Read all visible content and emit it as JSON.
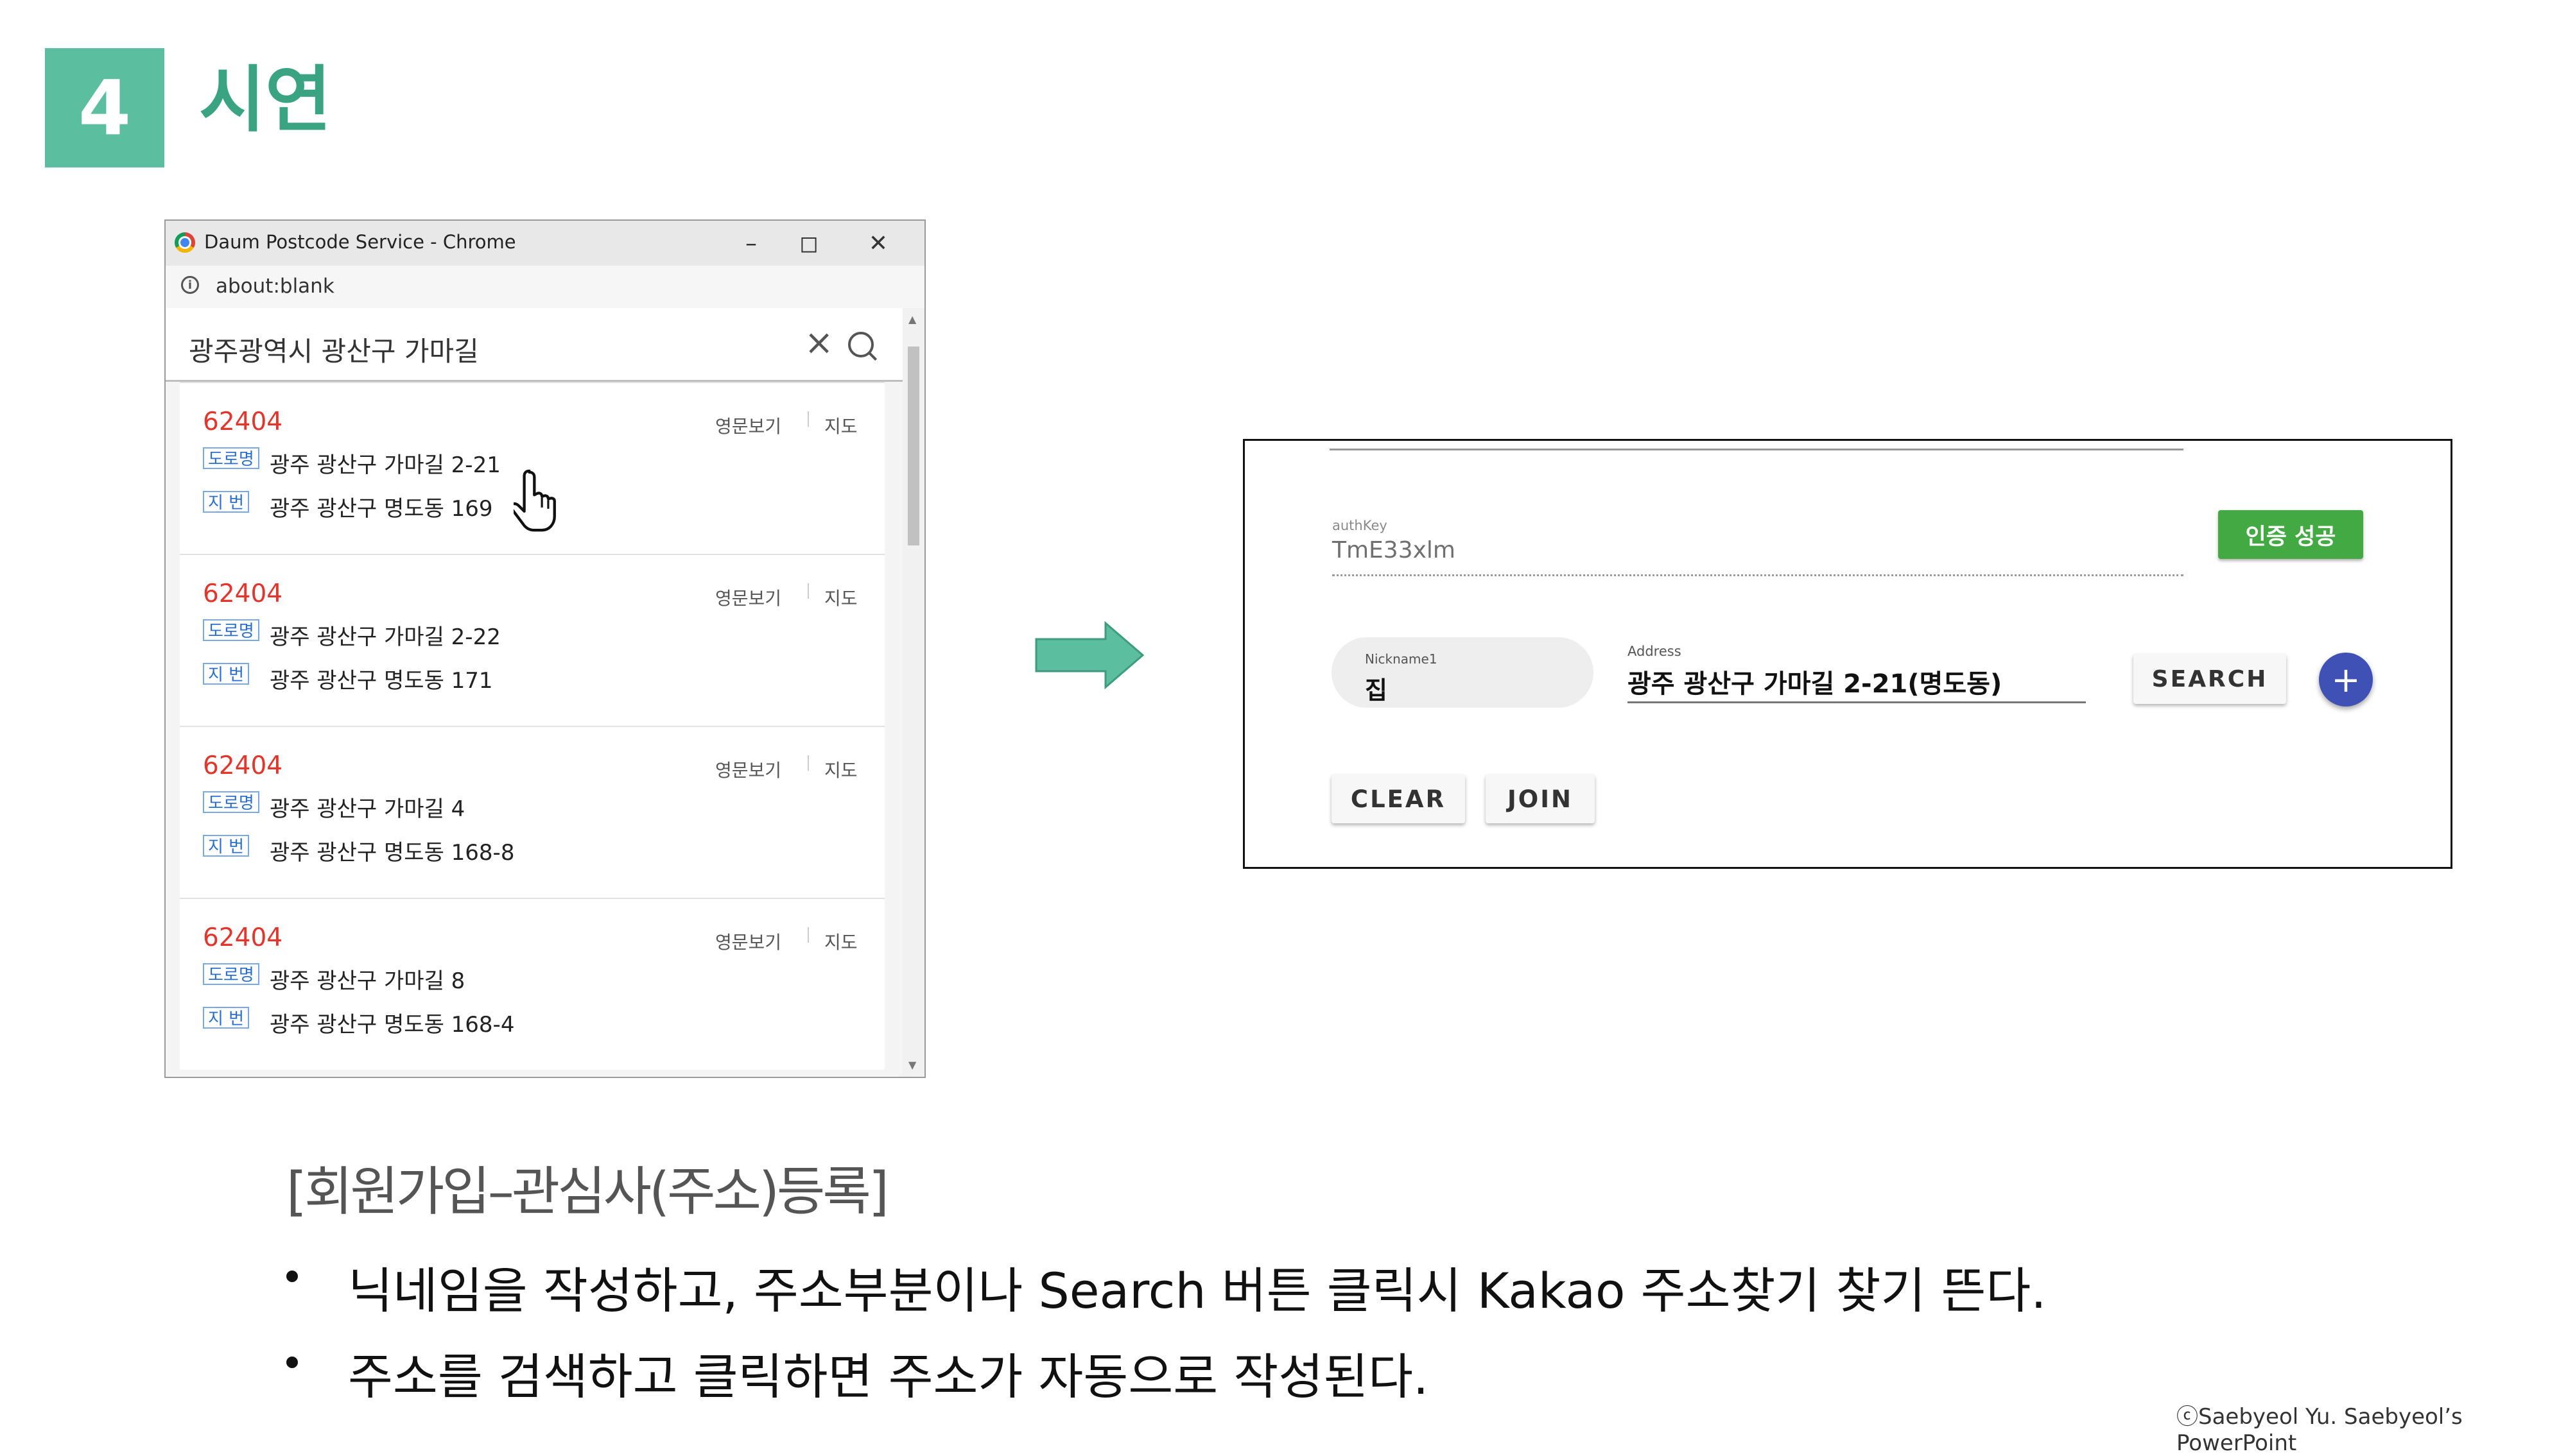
{
  "slide": {
    "number": "4",
    "title": "시연",
    "subtitle": "[회원가입–관심사(주소)등록]",
    "bullets": [
      "닉네임을 작성하고, 주소부분이나 Search 버튼 클릭시 Kakao 주소찾기 찾기 뜬다.",
      "주소를 검색하고 클릭하면 주소가 자동으로 작성된다."
    ],
    "copyright": "ⓒSaebyeol Yu. Saebyeol’s PowerPoint"
  },
  "popup": {
    "window_title": "Daum Postcode Service - Chrome",
    "url": "about:blank",
    "search_query": "광주광역시 광산구 가마길",
    "eng_label": "영문보기",
    "map_label": "지도",
    "road_tag": "도로명",
    "jibun_tag": "지 번",
    "results": [
      {
        "zip": "62404",
        "road": "광주 광산구 가마길 2-21",
        "jibun": "광주 광산구 명도동 169"
      },
      {
        "zip": "62404",
        "road": "광주 광산구 가마길 2-22",
        "jibun": "광주 광산구 명도동 171"
      },
      {
        "zip": "62404",
        "road": "광주 광산구 가마길 4",
        "jibun": "광주 광산구 명도동 168-8"
      },
      {
        "zip": "62404",
        "road": "광주 광산구 가마길 8",
        "jibun": "광주 광산구 명도동 168-4"
      }
    ]
  },
  "form": {
    "authkey_label": "authKey",
    "authkey_value": "TmE33xlm",
    "auth_button": "인증 성공",
    "nickname_label": "Nickname1",
    "nickname_value": "집",
    "address_label": "Address",
    "address_value": "광주 광산구 가마길 2-21(명도동)",
    "search_button": "SEARCH",
    "add_button": "+",
    "clear_button": "CLEAR",
    "join_button": "JOIN"
  },
  "colors": {
    "accent": "#5bbf9f",
    "title": "#3aa381",
    "zip_red": "#e2352b",
    "auth_green": "#43a943",
    "plus_indigo": "#3f51b5"
  },
  "icons": [
    "chrome-icon",
    "minimize-icon",
    "maximize-icon",
    "close-icon",
    "info-icon",
    "clear-icon",
    "search-icon",
    "hand-cursor-icon",
    "right-arrow-icon",
    "plus-icon"
  ]
}
